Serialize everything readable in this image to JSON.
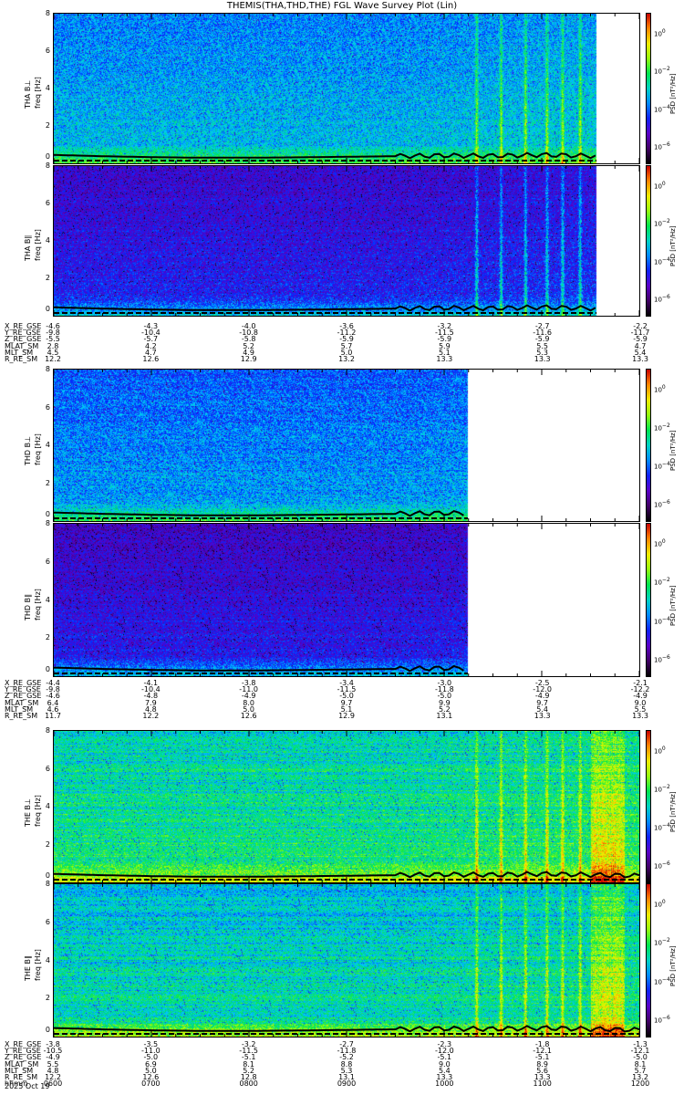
{
  "title": "THEMIS(THA,THD,THE) FGL Wave Survey Plot (Lin)",
  "colorbar": {
    "label": "PSD [nT²/Hz]",
    "ticks": [
      "10^0",
      "10^-2",
      "10^-4",
      "10^-6"
    ],
    "tick_exponents": [
      0,
      -2,
      -4,
      -6
    ],
    "range_log10": [
      -7,
      1
    ]
  },
  "chart_data": {
    "type": "heatmap",
    "title": "THEMIS(THA,THD,THE) FGL Wave Survey Plot (Lin)",
    "xlabel": "hhmm",
    "x_range_hours": [
      6,
      12
    ],
    "x_ticks": [
      "0600",
      "0700",
      "0800",
      "0900",
      "1000",
      "1100",
      "1200"
    ],
    "ylabel": "freq [Hz]",
    "ylim": [
      0,
      8
    ],
    "y_ticks": [
      "0",
      "2",
      "4",
      "6",
      "8"
    ],
    "date": "2025 Oct 19",
    "panels": [
      {
        "probe": "THA",
        "component": "B⊥",
        "label": "THA B⊥",
        "data_end_hour": 11.56,
        "level_log10": -3.2,
        "bands_hours": [
          10.33,
          10.58,
          10.83,
          11.05,
          11.21,
          11.39
        ]
      },
      {
        "probe": "THA",
        "component": "B∥",
        "label": "THA B∥",
        "data_end_hour": 11.56,
        "level_log10": -4.6,
        "bands_hours": [
          10.33,
          10.58,
          10.83,
          11.05,
          11.21,
          11.39
        ]
      },
      {
        "probe": "THD",
        "component": "B⊥",
        "label": "THD B⊥",
        "data_end_hour": 10.24,
        "level_log10": -3.5,
        "bands_hours": []
      },
      {
        "probe": "THD",
        "component": "B∥",
        "label": "THD B∥",
        "data_end_hour": 10.24,
        "level_log10": -4.7,
        "bands_hours": []
      },
      {
        "probe": "THE",
        "component": "B⊥",
        "label": "THE B⊥",
        "data_end_hour": 12.0,
        "level_log10": -2.3,
        "bands_hours": [
          10.33,
          10.58,
          10.83,
          11.05,
          11.21,
          11.39,
          11.55,
          11.65,
          11.75
        ]
      },
      {
        "probe": "THE",
        "component": "B∥",
        "label": "THE B∥",
        "data_end_hour": 12.0,
        "level_log10": -2.6,
        "bands_hours": [
          10.33,
          10.58,
          10.83,
          11.05,
          11.21,
          11.39,
          11.55,
          11.65,
          11.75
        ]
      }
    ],
    "gyro_line_hz": {
      "hours": [
        6,
        6.5,
        7,
        7.5,
        8,
        8.5,
        9,
        9.5,
        10,
        10.5,
        11,
        11.5,
        12
      ],
      "values": [
        0.45,
        0.38,
        0.33,
        0.3,
        0.3,
        0.32,
        0.35,
        0.38,
        0.42,
        0.4,
        0.45,
        0.4,
        0.35
      ]
    }
  },
  "ephemeris": [
    {
      "probe": "THA",
      "rows": [
        {
          "label": "X_RE_GSE",
          "values": [
            "-4.6",
            "-4.3",
            "-4.0",
            "-3.6",
            "-3.2",
            "-2.7",
            "-2.2"
          ]
        },
        {
          "label": "Y_RE_GSE",
          "values": [
            "-9.8",
            "-10.4",
            "-10.8",
            "-11.2",
            "-11.5",
            "-11.6",
            "-11.7"
          ]
        },
        {
          "label": "Z_RE_GSE",
          "values": [
            "-5.5",
            "-5.7",
            "-5.8",
            "-5.9",
            "-5.9",
            "-5.9",
            "-5.9"
          ]
        },
        {
          "label": "MLAT_SM",
          "values": [
            "2.8",
            "4.2",
            "5.2",
            "5.7",
            "5.9",
            "5.5",
            "4.7"
          ]
        },
        {
          "label": "MLT_SM",
          "values": [
            "4.5",
            "4.7",
            "4.9",
            "5.0",
            "5.1",
            "5.3",
            "5.4"
          ]
        },
        {
          "label": "R_RE_SM",
          "values": [
            "12.2",
            "12.6",
            "12.9",
            "13.2",
            "13.3",
            "13.3",
            "13.3"
          ]
        }
      ]
    },
    {
      "probe": "THD",
      "rows": [
        {
          "label": "X_RE_GSE",
          "values": [
            "-4.4",
            "-4.1",
            "-3.8",
            "-3.4",
            "-3.0",
            "-2.5",
            "-2.1"
          ]
        },
        {
          "label": "Y_RE_GSE",
          "values": [
            "-9.8",
            "-10.4",
            "-11.0",
            "-11.5",
            "-11.8",
            "-12.0",
            "-12.2"
          ]
        },
        {
          "label": "Z_RE_GSE",
          "values": [
            "-4.6",
            "-4.8",
            "-4.9",
            "-5.0",
            "-5.0",
            "-4.9",
            "-4.9"
          ]
        },
        {
          "label": "MLAT_SM",
          "values": [
            "6.4",
            "7.9",
            "8.0",
            "9.7",
            "9.9",
            "9.7",
            "9.0"
          ]
        },
        {
          "label": "MLT_SM",
          "values": [
            "4.6",
            "4.8",
            "5.0",
            "5.1",
            "5.2",
            "5.4",
            "5.5"
          ]
        },
        {
          "label": "R_RE_SM",
          "values": [
            "11.7",
            "12.2",
            "12.6",
            "12.9",
            "13.1",
            "13.3",
            "13.3"
          ]
        }
      ]
    },
    {
      "probe": "THE",
      "rows": [
        {
          "label": "X_RE_GSE",
          "values": [
            "-3.8",
            "-3.5",
            "-3.2",
            "-2.7",
            "-2.3",
            "-1.8",
            "-1.3"
          ]
        },
        {
          "label": "Y_RE_GSE",
          "values": [
            "-10.5",
            "-11.0",
            "-11.5",
            "-11.8",
            "-12.0",
            "-12.1",
            "-12.1"
          ]
        },
        {
          "label": "Z_RE_GSE",
          "values": [
            "-4.9",
            "-5.0",
            "-5.1",
            "-5.2",
            "-5.1",
            "-5.1",
            "-5.0"
          ]
        },
        {
          "label": "MLAT_SM",
          "values": [
            "5.5",
            "6.9",
            "8.1",
            "8.8",
            "9.0",
            "8.9",
            "8.1"
          ]
        },
        {
          "label": "MLT_SM",
          "values": [
            "4.8",
            "5.0",
            "5.2",
            "5.3",
            "5.4",
            "5.6",
            "5.7"
          ]
        },
        {
          "label": "R_RE_SM",
          "values": [
            "12.2",
            "12.6",
            "12.8",
            "13.1",
            "13.3",
            "13.3",
            "13.2"
          ]
        },
        {
          "label": "hhmm",
          "values": [
            "0600",
            "0700",
            "0800",
            "0900",
            "1000",
            "1100",
            "1200"
          ]
        }
      ]
    }
  ],
  "date_label": "2025 Oct 19"
}
